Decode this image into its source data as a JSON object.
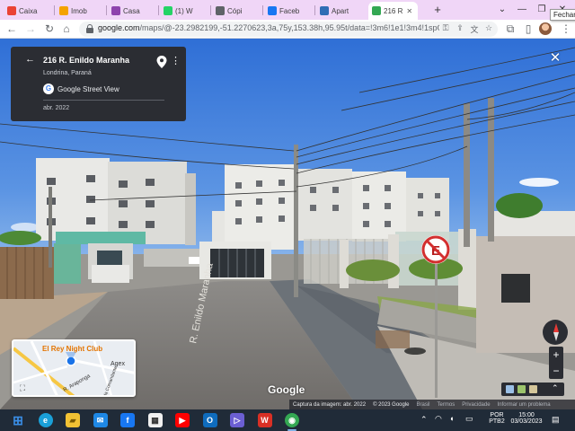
{
  "browser": {
    "tabs": [
      {
        "label": "Caixa",
        "icon": "gmail-icon",
        "color": "#ea4335",
        "active": false
      },
      {
        "label": "Imob",
        "icon": "imob-icon",
        "color": "#f4a300",
        "active": false
      },
      {
        "label": "Casa",
        "icon": "casa-icon",
        "color": "#8e44ad",
        "active": false
      },
      {
        "label": "(1) W",
        "icon": "whatsapp-icon",
        "color": "#25d366",
        "active": false
      },
      {
        "label": "Cópi",
        "icon": "copy-icon",
        "color": "#5f6368",
        "active": false
      },
      {
        "label": "Faceb",
        "icon": "facebook-icon",
        "color": "#1877f2",
        "active": false
      },
      {
        "label": "Apart",
        "icon": "apart-icon",
        "color": "#2f6db5",
        "active": false
      },
      {
        "label": "216 R",
        "icon": "maps-icon",
        "color": "#34a853",
        "active": true
      }
    ],
    "new_tab_label": "+",
    "tooltip": "Fechar",
    "url_host": "google.com",
    "url_path": "/maps/@-23.2982199,-51.2270623,3a,75y,153.38h,95.95t/data=!3m6!1e1!3m4!1spGX..."
  },
  "map": {
    "place_title": "216 R. Enildo Maranha",
    "place_subtitle": "Londrina, Paraná",
    "source_label": "Google Street View",
    "capture_date": "abr. 2022",
    "street_sign": "R. Enildo Maranha",
    "google_label": "Google",
    "minimap": {
      "poi": "El Rey Night Club",
      "labels": [
        "Agex",
        "R. Araponga",
        "Avenida Comandante"
      ]
    },
    "footer": [
      "Captura da imagem: abr. 2022",
      "© 2023 Google",
      "Brasil",
      "Termos",
      "Privacidade",
      "Informar um problema"
    ],
    "zoom_in": "+",
    "zoom_out": "−"
  },
  "taskbar": {
    "language": "POR",
    "keyboard": "PTB2",
    "time": "15:00",
    "date": "03/03/2023",
    "apps": [
      {
        "name": "windows-start-icon",
        "color": "#3a8ee6"
      },
      {
        "name": "edge-icon",
        "color": "#1aa0d8"
      },
      {
        "name": "file-explorer-icon",
        "color": "#f2c234"
      },
      {
        "name": "mail-icon",
        "color": "#1e88e5"
      },
      {
        "name": "facebook-icon",
        "color": "#1877f2"
      },
      {
        "name": "store-icon",
        "color": "#f0f0f0"
      },
      {
        "name": "youtube-icon",
        "color": "#ff0000"
      },
      {
        "name": "outlook-icon",
        "color": "#0f6cbd"
      },
      {
        "name": "media-player-icon",
        "color": "#6b5fd3"
      },
      {
        "name": "wps-icon",
        "color": "#d93025"
      },
      {
        "name": "chrome-icon",
        "color": "#34a853"
      }
    ]
  }
}
